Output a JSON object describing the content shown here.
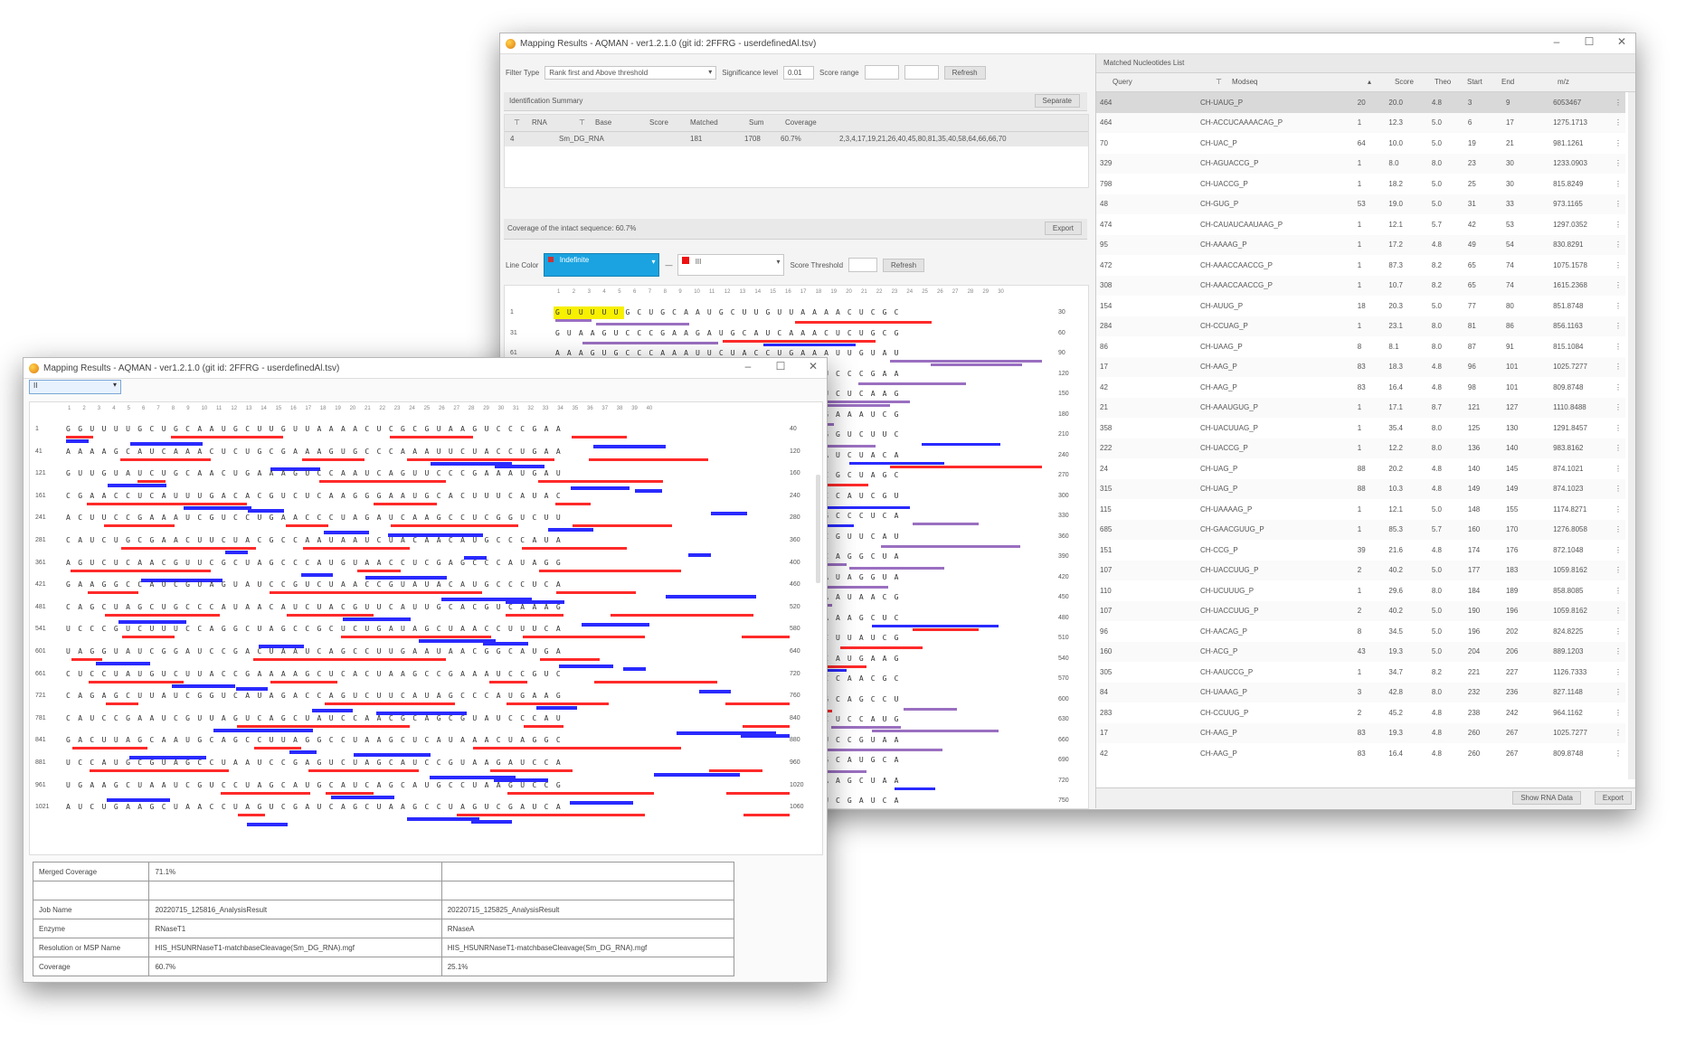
{
  "back_window": {
    "title": "Mapping Results - AQMAN - ver1.2.1.0 (git id: 2FFRG - userdefinedAl.tsv)",
    "filter_type_label": "Filter Type",
    "filter_type_value": "Rank first and Above threshold",
    "significance_label": "Significance level",
    "significance_value": "0.01",
    "score_range_label": "Score range",
    "refresh_label": "Refresh",
    "id_summary_label": "Identification Summary",
    "separate_label": "Separate",
    "summary_headers": [
      "RNA",
      "Base",
      "Score",
      "Matched",
      "Sum",
      "Coverage"
    ],
    "summary_row": [
      "4",
      "Sm_DG_RNA",
      "",
      "181",
      "1708",
      "60.7%",
      "2,3,4,17,19,21,26,40,45,80,81,35,40,58,64,66,66,70"
    ],
    "coverage_text": "Coverage of the intact sequence: 60.7%",
    "export_label": "Export",
    "line_color_label": "Line Color",
    "line_color_value": "Indefinite",
    "color2_value": "III",
    "score_threshold_label": "Score Threshold",
    "apply_label": "Refresh",
    "matched_list_label": "Matched Nucleotides List",
    "list_headers": [
      "Query",
      "Modseq",
      "",
      "Score",
      "Theo",
      "Start",
      "End",
      "m/z"
    ],
    "show_rna_data_label": "Show RNA Data",
    "export2_label": "Export",
    "list_rows": [
      [
        "464",
        "CH-UAUG_P",
        "20",
        "20.0",
        "4.8",
        "3",
        "9",
        "6053467"
      ],
      [
        "464",
        "CH-ACCUCAAAACAG_P",
        "1",
        "12.3",
        "5.0",
        "6",
        "17",
        "1275.1713"
      ],
      [
        "70",
        "CH-UAC_P",
        "64",
        "10.0",
        "5.0",
        "19",
        "21",
        "981.1261"
      ],
      [
        "329",
        "CH-AGUACCG_P",
        "1",
        "8.0",
        "8.0",
        "23",
        "30",
        "1233.0903"
      ],
      [
        "798",
        "CH-UACCG_P",
        "1",
        "18.2",
        "5.0",
        "25",
        "30",
        "815.8249"
      ],
      [
        "48",
        "CH-GUG_P",
        "53",
        "19.0",
        "5.0",
        "31",
        "33",
        "973.1165"
      ],
      [
        "474",
        "CH-CAUAUCAAUAAG_P",
        "1",
        "12.1",
        "5.7",
        "42",
        "53",
        "1297.0352"
      ],
      [
        "95",
        "CH-AAAAG_P",
        "1",
        "17.2",
        "4.8",
        "49",
        "54",
        "830.8291"
      ],
      [
        "472",
        "CH-AAACCAACCG_P",
        "1",
        "87.3",
        "8.2",
        "65",
        "74",
        "1075.1578"
      ],
      [
        "308",
        "CH-AAACCAACCG_P",
        "1",
        "10.7",
        "8.2",
        "65",
        "74",
        "1615.2368"
      ],
      [
        "154",
        "CH-AUUG_P",
        "18",
        "20.3",
        "5.0",
        "77",
        "80",
        "851.8748"
      ],
      [
        "284",
        "CH-CCUAG_P",
        "1",
        "23.1",
        "8.0",
        "81",
        "86",
        "856.1163"
      ],
      [
        "86",
        "CH-UAAG_P",
        "8",
        "8.1",
        "8.0",
        "87",
        "91",
        "815.1084"
      ],
      [
        "17",
        "CH-AAG_P",
        "83",
        "18.3",
        "4.8",
        "96",
        "101",
        "1025.7277"
      ],
      [
        "42",
        "CH-AAG_P",
        "83",
        "16.4",
        "4.8",
        "98",
        "101",
        "809.8748"
      ],
      [
        "21",
        "CH-AAAUGUG_P",
        "1",
        "17.1",
        "8.7",
        "121",
        "127",
        "1110.8488"
      ],
      [
        "358",
        "CH-UACUUAG_P",
        "1",
        "35.4",
        "8.0",
        "125",
        "130",
        "1291.8457"
      ],
      [
        "222",
        "CH-UACCG_P",
        "1",
        "12.2",
        "8.0",
        "136",
        "140",
        "983.8162"
      ],
      [
        "24",
        "CH-UAG_P",
        "88",
        "20.2",
        "4.8",
        "140",
        "145",
        "874.1021"
      ],
      [
        "315",
        "CH-UAG_P",
        "88",
        "10.3",
        "4.8",
        "149",
        "149",
        "874.1023"
      ],
      [
        "115",
        "CH-UAAAAG_P",
        "1",
        "12.1",
        "5.0",
        "148",
        "155",
        "1174.8271"
      ],
      [
        "685",
        "CH-GAACGUUG_P",
        "1",
        "85.3",
        "5.7",
        "160",
        "170",
        "1276.8058"
      ],
      [
        "151",
        "CH-CCG_P",
        "39",
        "21.6",
        "4.8",
        "174",
        "176",
        "872.1048"
      ],
      [
        "107",
        "CH-UACCUUG_P",
        "2",
        "40.2",
        "5.0",
        "177",
        "183",
        "1059.8162"
      ],
      [
        "110",
        "CH-UCUUUG_P",
        "1",
        "29.6",
        "8.0",
        "184",
        "189",
        "858.8085"
      ],
      [
        "107",
        "CH-UACCUUG_P",
        "2",
        "40.2",
        "5.0",
        "190",
        "196",
        "1059.8162"
      ],
      [
        "96",
        "CH-AACAG_P",
        "8",
        "34.5",
        "5.0",
        "196",
        "202",
        "824.8225"
      ],
      [
        "160",
        "CH-ACG_P",
        "43",
        "19.3",
        "5.0",
        "204",
        "206",
        "889.1203"
      ],
      [
        "305",
        "CH-AAUCCG_P",
        "1",
        "34.7",
        "8.2",
        "221",
        "227",
        "1126.7333"
      ],
      [
        "84",
        "CH-UAAAG_P",
        "3",
        "42.8",
        "8.0",
        "232",
        "236",
        "827.1148"
      ],
      [
        "283",
        "CH-CCUUG_P",
        "2",
        "45.2",
        "4.8",
        "238",
        "242",
        "964.1162"
      ],
      [
        "17",
        "CH-AAG_P",
        "83",
        "19.3",
        "4.8",
        "260",
        "267",
        "1025.7277"
      ],
      [
        "42",
        "CH-AAG_P",
        "83",
        "16.4",
        "4.8",
        "260",
        "267",
        "809.8748"
      ]
    ],
    "ruler_numbers": [
      "1",
      "2",
      "3",
      "4",
      "5",
      "6",
      "7",
      "8",
      "9",
      "10",
      "11",
      "12",
      "13",
      "14",
      "15",
      "16",
      "17",
      "18",
      "19",
      "20",
      "21",
      "22",
      "23",
      "24",
      "25",
      "26",
      "27",
      "28",
      "29",
      "30"
    ],
    "row_start_numbers": [
      "1",
      "31",
      "61",
      "91",
      "121",
      "151",
      "181",
      "211",
      "241",
      "271",
      "301",
      "331",
      "361",
      "391",
      "421",
      "451",
      "481",
      "511",
      "541",
      "571",
      "601",
      "631",
      "661",
      "691",
      "721",
      "751"
    ],
    "row_end_numbers": [
      "30",
      "60",
      "90",
      "120",
      "150",
      "180",
      "210",
      "240",
      "270",
      "300",
      "330",
      "360",
      "390",
      "420",
      "450",
      "480",
      "510",
      "540",
      "570",
      "600",
      "630",
      "660",
      "690",
      "720",
      "750",
      "780"
    ],
    "seq_rows": [
      "GUUUUUGCUGCAAUGCUUGUUAAAACUCGC",
      "GUAAGUCCCGAAGAUGCAUCAAACUCUGCG",
      "AAAGUGCCCAAAUUCUACCUGAAAUUGUAU",
      "CUGCAACUGAAAGUCCAAUCAGUUCCCGAA",
      "AUGAUCGAACCUCAUUUGACACGUCUCAAG",
      "GGAAUGCACUUUCAUACACUUCCGAAAUCG",
      "UCCUGAACCCUAGAUCAAGCCUCGGUCUUC",
      "AUCUGCGAACUUCUACGCCAAUAAUCUACA",
      "ACAUGCCCAUAAGUCUCAACGUUCGCUAGC",
      "CCAUGUAACCUCGAGCCCAUAGGCCAUCGU",
      "AGUAUCCGUCUAACCGUAUACAUGCCCUCA",
      "CAGCUAGCUGCCCAUAACAUCUACGUUCAU",
      "UGCACGUCAAAGUCCCGUCUUUCCAGGCUA",
      "GCCGCUCUGAUAGCUAACCUUUCAUAGGUA",
      "UCGGAUCCGACUAAUCAGCCUUGAAUAACG",
      "GCAUGACUCCUAUGUCUUACCGAAAAGCUC",
      "ACUAAGCCGAAAUCCGUCCAGAGCUUAUCG",
      "GUCAUAGACCAGUCUUCAUAGCCCAUGAAG",
      "CAUCCGAAUCGUUAGUCAGCUAUCCAACGC",
      "AGCGUAUCCCAUGACUUAGCAAUGCAGCCU",
      "UAGGCCUAAGCUCAUAAACUAGGCUCCAUG",
      "CGUAGCCUAAUCCGAGUCUAGCAUCCGUAA",
      "GAUCCAUGAAGCUAAUCGUCCUAGCAUGCA",
      "UCAGCAUGCCUAAGUCCGAUCUGAAGCUAA",
      "CCUAGUCGAUCAGCUAAGCCUAGUCGAUCA",
      "AGCUAACGUCCAGUCUAGCAUCGGAUCCUA"
    ],
    "highlight_text": "GUUUU"
  },
  "front_window": {
    "title": "Mapping Results - AQMAN - ver1.2.1.0 (git id: 2FFRG - userdefinedAl.tsv)",
    "dropdown_value": "II",
    "ruler_numbers": [
      "1",
      "2",
      "3",
      "4",
      "5",
      "6",
      "7",
      "8",
      "9",
      "10",
      "11",
      "12",
      "13",
      "14",
      "15",
      "16",
      "17",
      "18",
      "19",
      "20",
      "21",
      "22",
      "23",
      "24",
      "25",
      "26",
      "27",
      "28",
      "29",
      "30",
      "31",
      "32",
      "33",
      "34",
      "35",
      "36",
      "37",
      "38",
      "39",
      "40"
    ],
    "row_start_numbers": [
      "1",
      "41",
      "121",
      "161",
      "241",
      "281",
      "361",
      "421",
      "481",
      "541",
      "601",
      "661",
      "721",
      "781",
      "841",
      "881",
      "961",
      "1021"
    ],
    "row_end_numbers": [
      "40",
      "120",
      "160",
      "240",
      "280",
      "360",
      "400",
      "460",
      "520",
      "580",
      "640",
      "720",
      "760",
      "840",
      "880",
      "960",
      "1020",
      "1060"
    ],
    "seq_rows": [
      "GGUUUUGCUGCAAUGCUUGUUAAAACUCGCGUAAGUCCCGAA",
      "AAAAGCAUCAAACUCUGCGAAAGUGCCCAAAUUCUACCUGAA",
      "GUUGUAUCUGCAACUGAAAGUCCAAUCAGUUCCCGAAAUGAU",
      "CGAACCUCAUUUGACACGUCUCAAGGGAAUGCACUUUCAUAC",
      "ACUUCCGAAAUCGUCCUGAACCCUAGAUCAAGCCUCGGUCUU",
      "CAUCUGCGAACUUCUACGCCAAUAAUCUACAACAUGCCCAUA",
      "AGUCUCAACGUUCGCUAGCCCAUGUAACCUCGAGCCCAUAGG",
      "GAAGGCCAUCGUAGUAUCCGUCUAACCGUAUACAUGCCCUCA",
      "CAGCUAGCUGCCCAUAACAUCUACGUUCAUUGCACGUCAAAG",
      "UCCCGUCUUUCCAGGCUAGCCGCUCUGAUAGCUAACCUUUCA",
      "UAGGUAUCGGAUCCGACUAAUCAGCCUUGAAUAACGGCAUGA",
      "CUCCUAUGUCUUACCGAAAAGCUCACUAAGCCGAAAUCCGUC",
      "CAGAGCUUAUCGGUCAUAGACCAGUCUUCAUAGCCCAUGAAG",
      "CAUCCGAAUCGUUAGUCAGCUAUCCAACGCAGCGUAUCCCAU",
      "GACUUAGCAAUGCAGCCUUAGGCCUAAGCUCAUAAACUAGGC",
      "UCCAUGCGUAGCCUAAUCCGAGUCUAGCAUCCGUAAGAUCCA",
      "UGAAGCUAAUCGUCCUAGCAUGCAUCAGCAUGCCUAAGUCCG",
      "AUCUGAAGCUAACCUAGUCGAUCAGCUAAGCCUAGUCGAUCA"
    ],
    "table_rows": [
      {
        "label": "Merged Coverage",
        "v1": "71.1%",
        "v2": ""
      },
      {
        "label": "",
        "v1": "",
        "v2": ""
      },
      {
        "label": "Job Name",
        "v1": "20220715_125816_AnalysisResult",
        "v2": "20220715_125825_AnalysisResult"
      },
      {
        "label": "Enzyme",
        "v1": "RNaseT1",
        "v2": "RNaseA"
      },
      {
        "label": "Resolution or MSP Name",
        "v1": "HIS_HSUNRNaseT1-matchbaseCleavage(Sm_DG_RNA).mgf",
        "v2": "HIS_HSUNRNaseT1-matchbaseCleavage(Sm_DG_RNA).mgf"
      },
      {
        "label": "Coverage",
        "v1": "60.7%",
        "v2": "25.1%"
      }
    ]
  },
  "colors": {
    "red_bar": "#ff2a2a",
    "blue_bar": "#2a2aff",
    "purple_bar": "#9a6fc0",
    "highlight": "#f7f000",
    "line_color_combo": "#1aa3e0"
  }
}
